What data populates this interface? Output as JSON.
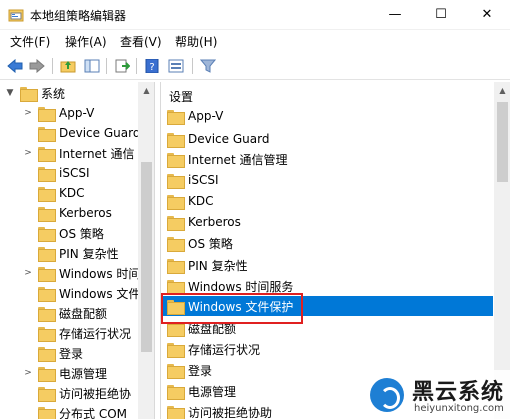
{
  "window": {
    "title": "本地组策略编辑器",
    "minimize": "—",
    "maximize": "☐",
    "close": "✕"
  },
  "menu": [
    "文件(F)",
    "操作(A)",
    "查看(V)",
    "帮助(H)"
  ],
  "left_tree": {
    "root": "系统",
    "items": [
      "App-V",
      "Device Guard",
      "Internet 通信",
      "iSCSI",
      "KDC",
      "Kerberos",
      "OS 策略",
      "PIN 复杂性",
      "Windows 时间",
      "Windows 文件",
      "磁盘配额",
      "存储运行状况",
      "登录",
      "电源管理",
      "访问被拒绝协",
      "分布式 COM"
    ]
  },
  "right_pane": {
    "header": "设置",
    "items": [
      "App-V",
      "Device Guard",
      "Internet 通信管理",
      "iSCSI",
      "KDC",
      "Kerberos",
      "OS 策略",
      "PIN 复杂性",
      "Windows 时间服务",
      "Windows 文件保护",
      "磁盘配额",
      "存储运行状况",
      "登录",
      "电源管理",
      "访问被拒绝协助"
    ],
    "selected_index": 9
  },
  "watermark": {
    "title": "黑云系统",
    "url": "heiyunxitong.com"
  },
  "colors": {
    "selection": "#0078d7",
    "highlight_border": "#e02020",
    "folder": "#f5cc62"
  }
}
